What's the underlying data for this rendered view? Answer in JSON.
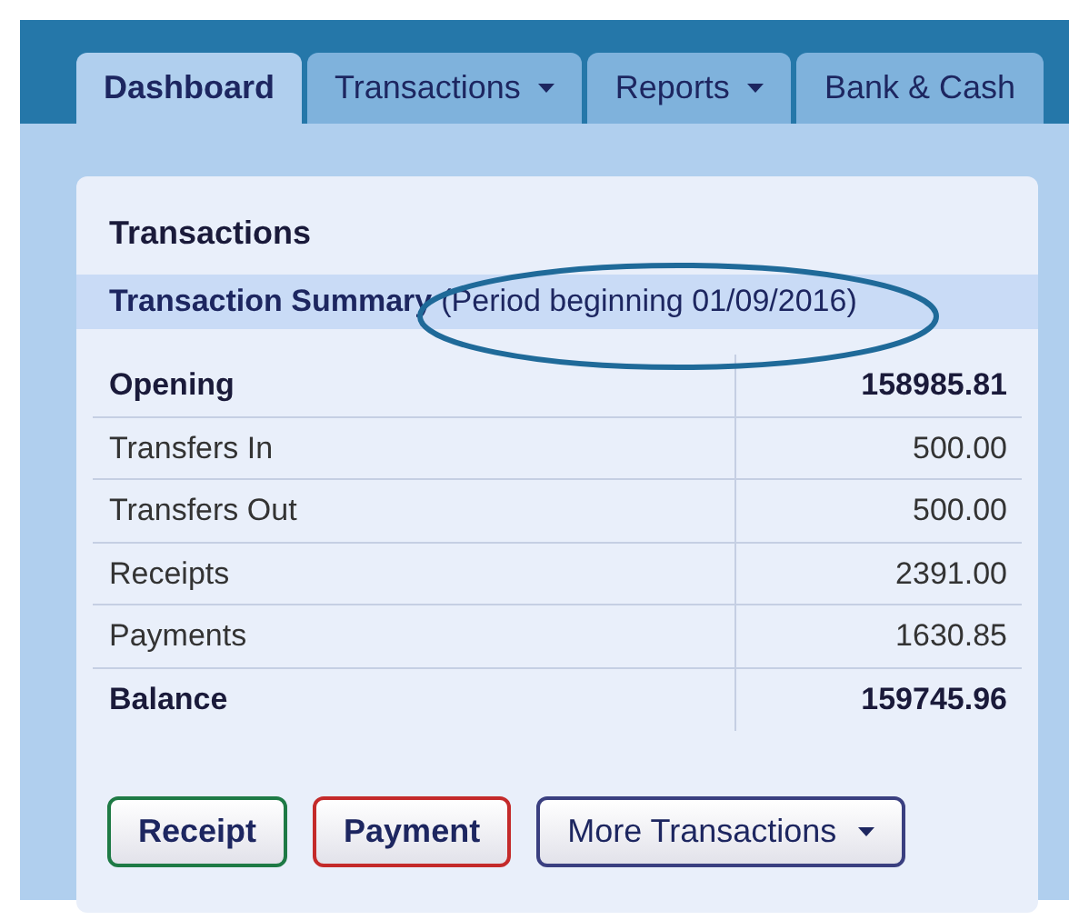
{
  "tabs": [
    {
      "label": "Dashboard",
      "selected": true,
      "dropdown": false
    },
    {
      "label": "Transactions",
      "selected": false,
      "dropdown": true
    },
    {
      "label": "Reports",
      "selected": false,
      "dropdown": true
    },
    {
      "label": "Bank & Cash",
      "selected": false,
      "dropdown": false
    }
  ],
  "panel": {
    "title": "Transactions",
    "summary": {
      "label": "Transaction Summary",
      "period": "(Period beginning 01/09/2016)"
    },
    "rows": [
      {
        "label": "Opening",
        "value": "158985.81",
        "kind": "total"
      },
      {
        "label": "Transfers In",
        "value": "500.00",
        "kind": "item"
      },
      {
        "label": "Transfers Out",
        "value": "500.00",
        "kind": "item"
      },
      {
        "label": "Receipts",
        "value": "2391.00",
        "kind": "item"
      },
      {
        "label": "Payments",
        "value": "1630.85",
        "kind": "item"
      },
      {
        "label": "Balance",
        "value": "159745.96",
        "kind": "total"
      }
    ],
    "buttons": [
      {
        "label": "Receipt",
        "color": "#1e7a45",
        "dropdown": false
      },
      {
        "label": "Payment",
        "color": "#c42a2a",
        "dropdown": false
      },
      {
        "label": "More Transactions",
        "color": "#3a3f80",
        "dropdown": true
      }
    ]
  }
}
